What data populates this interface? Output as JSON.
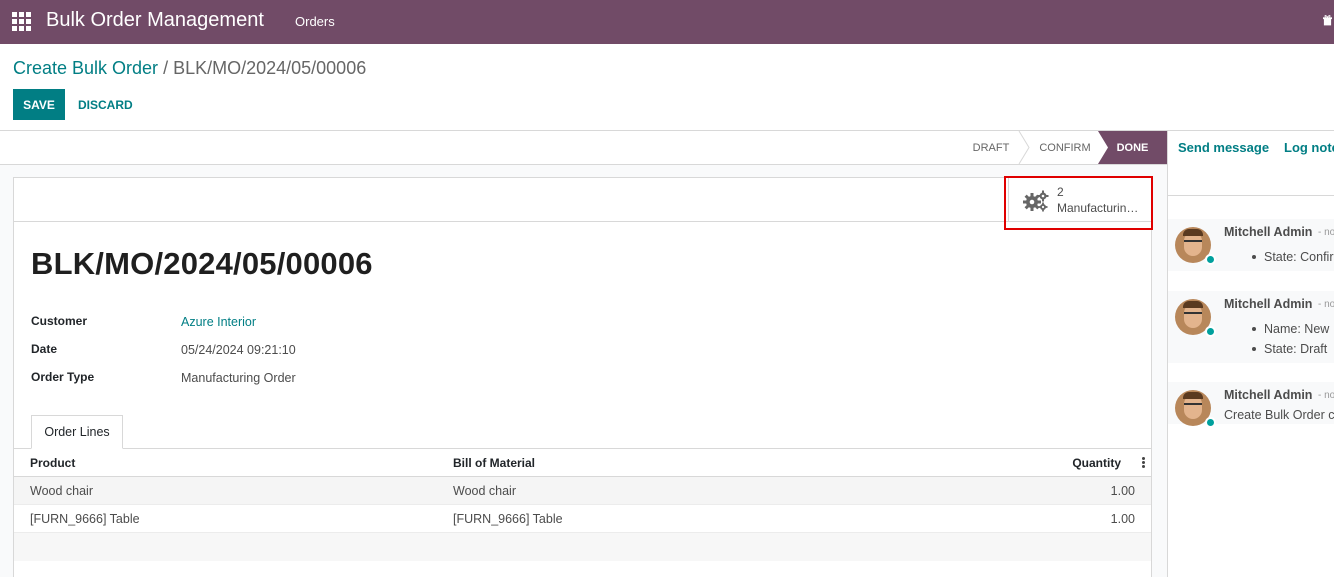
{
  "navbar": {
    "app_title": "Bulk Order Management",
    "menu_orders": "Orders"
  },
  "breadcrumb": {
    "parent": "Create Bulk Order",
    "separator": " / ",
    "current": "BLK/MO/2024/05/00006"
  },
  "actions": {
    "save": "SAVE",
    "discard": "DISCARD"
  },
  "statusbar": {
    "stages": [
      "DRAFT",
      "CONFIRM",
      "DONE"
    ],
    "active": "DONE"
  },
  "smart_button": {
    "value": "2",
    "label": "Manufacturin…"
  },
  "record": {
    "title": "BLK/MO/2024/05/00006",
    "fields": {
      "customer_label": "Customer",
      "customer_value": "Azure Interior",
      "date_label": "Date",
      "date_value": "05/24/2024 09:21:10",
      "order_type_label": "Order Type",
      "order_type_value": "Manufacturing Order"
    }
  },
  "tabs": {
    "order_lines": "Order Lines"
  },
  "order_lines": {
    "headers": {
      "product": "Product",
      "bom": "Bill of Material",
      "quantity": "Quantity"
    },
    "rows": [
      {
        "product": "Wood chair",
        "bom": "Wood chair",
        "quantity": "1.00"
      },
      {
        "product": "[FURN_9666] Table",
        "bom": "[FURN_9666] Table",
        "quantity": "1.00"
      }
    ]
  },
  "chatter": {
    "send_message": "Send message",
    "log_note": "Log note",
    "messages": [
      {
        "author": "Mitchell Admin",
        "when": "- no",
        "lines": [
          "State: Confir"
        ]
      },
      {
        "author": "Mitchell Admin",
        "when": "- no",
        "lines": [
          "Name: New",
          "State: Draft"
        ]
      },
      {
        "author": "Mitchell Admin",
        "when": "- no",
        "body": "Create Bulk Order c"
      }
    ]
  },
  "colors": {
    "brand": "#714b67",
    "accent": "#017e84",
    "highlight": "#e00000"
  }
}
